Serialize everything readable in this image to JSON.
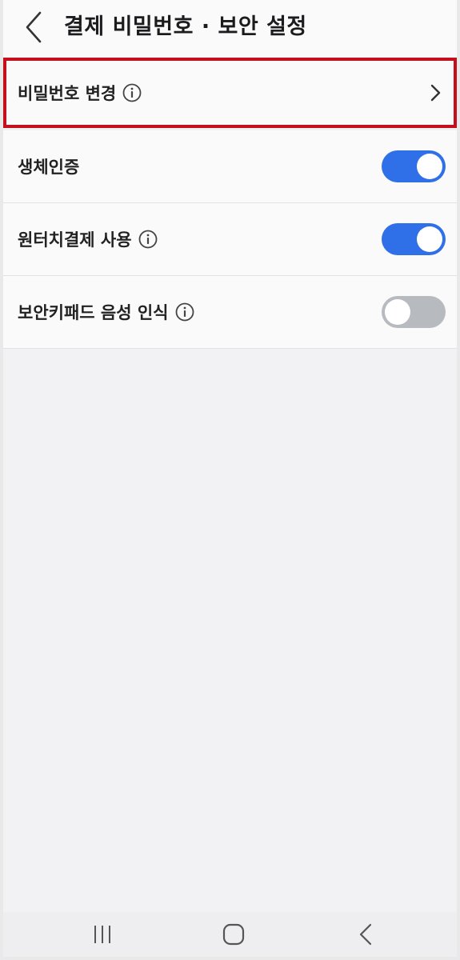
{
  "header": {
    "title": "결제 비밀번호 · 보안 설정",
    "back_icon": "chevron-left-icon"
  },
  "settings": [
    {
      "label": "비밀번호 변경",
      "has_info": true,
      "control": "chevron",
      "highlighted": true
    },
    {
      "label": "생체인증",
      "has_info": false,
      "control": "toggle",
      "enabled": true
    },
    {
      "label": "원터치결제 사용",
      "has_info": true,
      "control": "toggle",
      "enabled": true
    },
    {
      "label": "보안키패드 음성 인식",
      "has_info": true,
      "control": "toggle",
      "enabled": false
    }
  ],
  "navbar": {
    "recents_icon": "recent-apps-icon",
    "home_icon": "home-icon",
    "back_icon": "back-icon"
  },
  "colors": {
    "toggle_on": "#2f6fe8",
    "toggle_off": "#b7bbc0",
    "highlight_border": "#c4101c"
  }
}
